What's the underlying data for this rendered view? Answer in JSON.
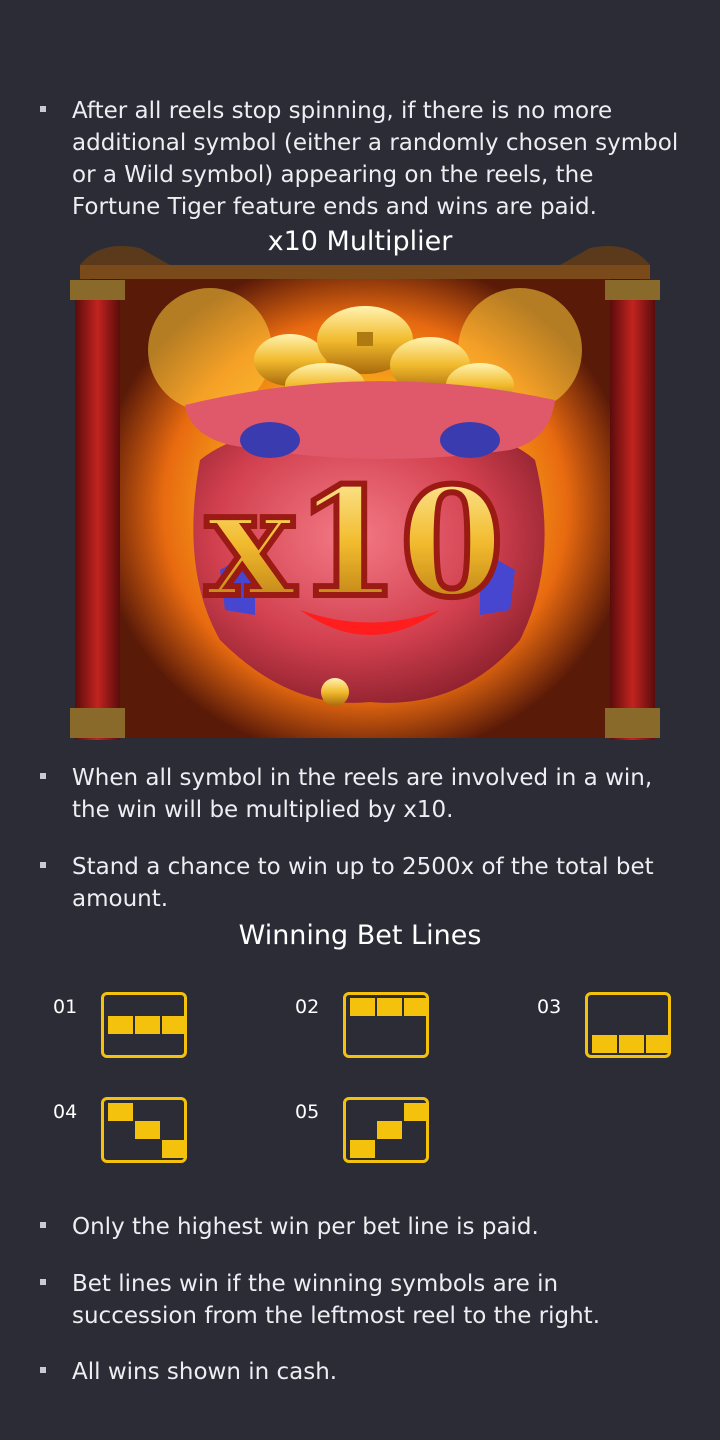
{
  "bullets_top": [
    {
      "text": "After all reels stop spinning, if there is no more additional symbol (either a randomly chosen symbol or a Wild symbol) appearing on the reels, the Fortune Tiger feature ends and wins are paid."
    }
  ],
  "multiplier_section": {
    "title": "x10 Multiplier",
    "badge_text": "x10",
    "colors": {
      "gold": "#f4c20d",
      "bag_red": "#d9485c",
      "glow": "#ffb31a"
    }
  },
  "bullets_middle": [
    {
      "text": "When all symbol in the reels are involved in a win, the win will be multiplied by x10."
    },
    {
      "text": "Stand a chance to win up to 2500x of the total bet amount."
    }
  ],
  "bet_lines_section": {
    "title": "Winning Bet Lines",
    "lines": [
      {
        "label": "01",
        "pattern": [
          "middle",
          "middle",
          "middle"
        ]
      },
      {
        "label": "02",
        "pattern": [
          "top",
          "top",
          "top"
        ]
      },
      {
        "label": "03",
        "pattern": [
          "bottom",
          "bottom",
          "bottom"
        ]
      },
      {
        "label": "04",
        "pattern": [
          "top",
          "middle",
          "bottom"
        ]
      },
      {
        "label": "05",
        "pattern": [
          "bottom",
          "middle",
          "top"
        ]
      }
    ]
  },
  "bullets_bottom": [
    {
      "text": "Only the highest win per bet line is paid."
    },
    {
      "text": "Bet lines win if the winning symbols are in succession from the leftmost reel to the right."
    },
    {
      "text": "All wins shown in cash."
    }
  ]
}
